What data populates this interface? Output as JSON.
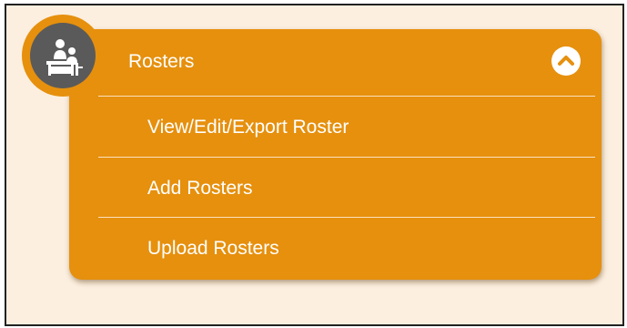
{
  "menu": {
    "title": "Rosters",
    "icon": "teacher-desk-icon",
    "toggle_icon": "chevron-up-icon",
    "expanded": true,
    "items": [
      {
        "label": "View/Edit/Export Roster"
      },
      {
        "label": "Add Rosters"
      },
      {
        "label": "Upload Rosters"
      }
    ]
  },
  "colors": {
    "page_background": "#fcefdf",
    "panel": "#e6900e",
    "avatar": "#5a5a5a",
    "text": "#ffffff"
  }
}
